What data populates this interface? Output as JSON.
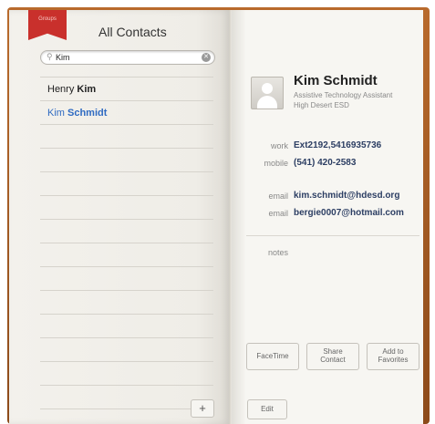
{
  "left_page": {
    "groups_label": "Groups",
    "title": "All Contacts",
    "search": {
      "value": "Kim",
      "placeholder": ""
    },
    "contacts": [
      {
        "first": "Henry ",
        "last": "Kim"
      },
      {
        "first": "Kim ",
        "last": "Schmidt"
      }
    ],
    "add_label": "+"
  },
  "contact": {
    "name": "Kim Schmidt",
    "job_title": "Assistive Technology Assistant",
    "company": "High Desert ESD",
    "fields": {
      "work_label": "work",
      "work_value": "Ext2192,5416935736",
      "mobile_label": "mobile",
      "mobile_value": "(541) 420-2583",
      "email1_label": "email",
      "email1_value": "kim.schmidt@hdesd.org",
      "email2_label": "email",
      "email2_value": "bergie0007@hotmail.com",
      "notes_label": "notes"
    },
    "buttons": {
      "facetime": "FaceTime",
      "share": "Share\nContact",
      "favorites": "Add to\nFavorites",
      "edit": "Edit"
    }
  },
  "colors": {
    "selected": "#2f6bc2",
    "ribbon": "#c9302c",
    "value_text": "#2c3e63"
  }
}
